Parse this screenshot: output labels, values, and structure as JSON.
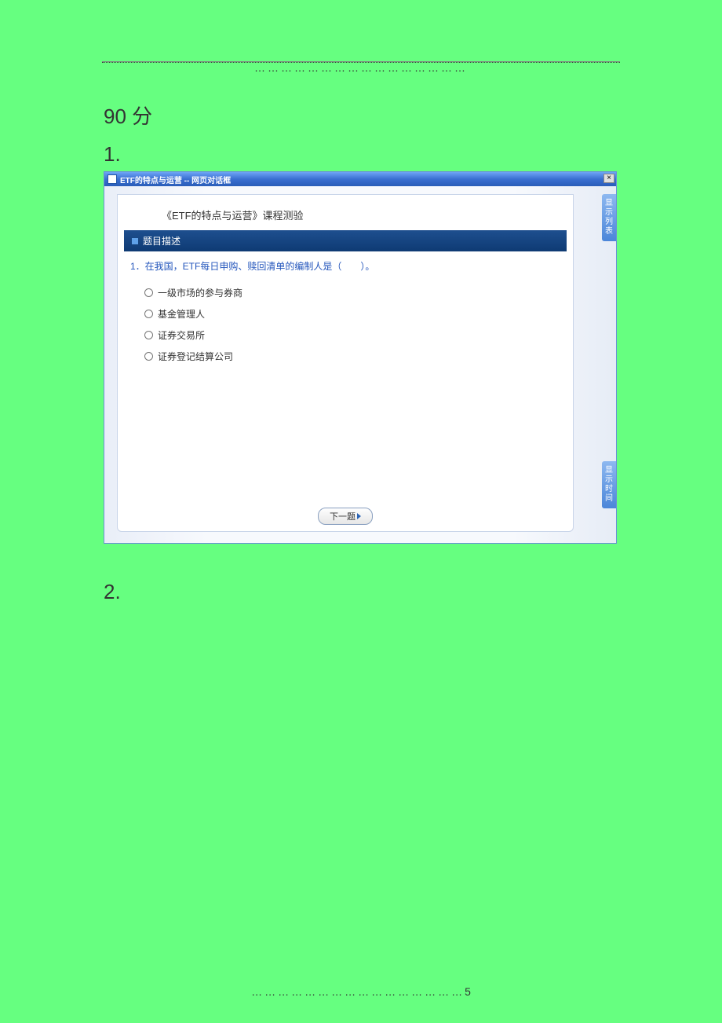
{
  "header": {
    "top_dots": "…………………………………………"
  },
  "score_line": "90 分",
  "q1_label": "1.",
  "dialog": {
    "title": "ETF的特点与运营 -- 网页对话框",
    "paper_title": "《ETF的特点与运营》课程测验",
    "section_label": "题目描述",
    "question_text": "1．在我国，ETF每日申购、赎回清单的编制人是（　　）。",
    "options": [
      "一级市场的参与券商",
      "基金管理人",
      "证券交易所",
      "证券登记结算公司"
    ],
    "side_tab_top": "显示列表",
    "side_tab_bot": "显示时间",
    "next_button": "下一题",
    "close_label": "×"
  },
  "q2_label": "2.",
  "footer": {
    "dots": "…………………………………………",
    "page_number": "5"
  }
}
